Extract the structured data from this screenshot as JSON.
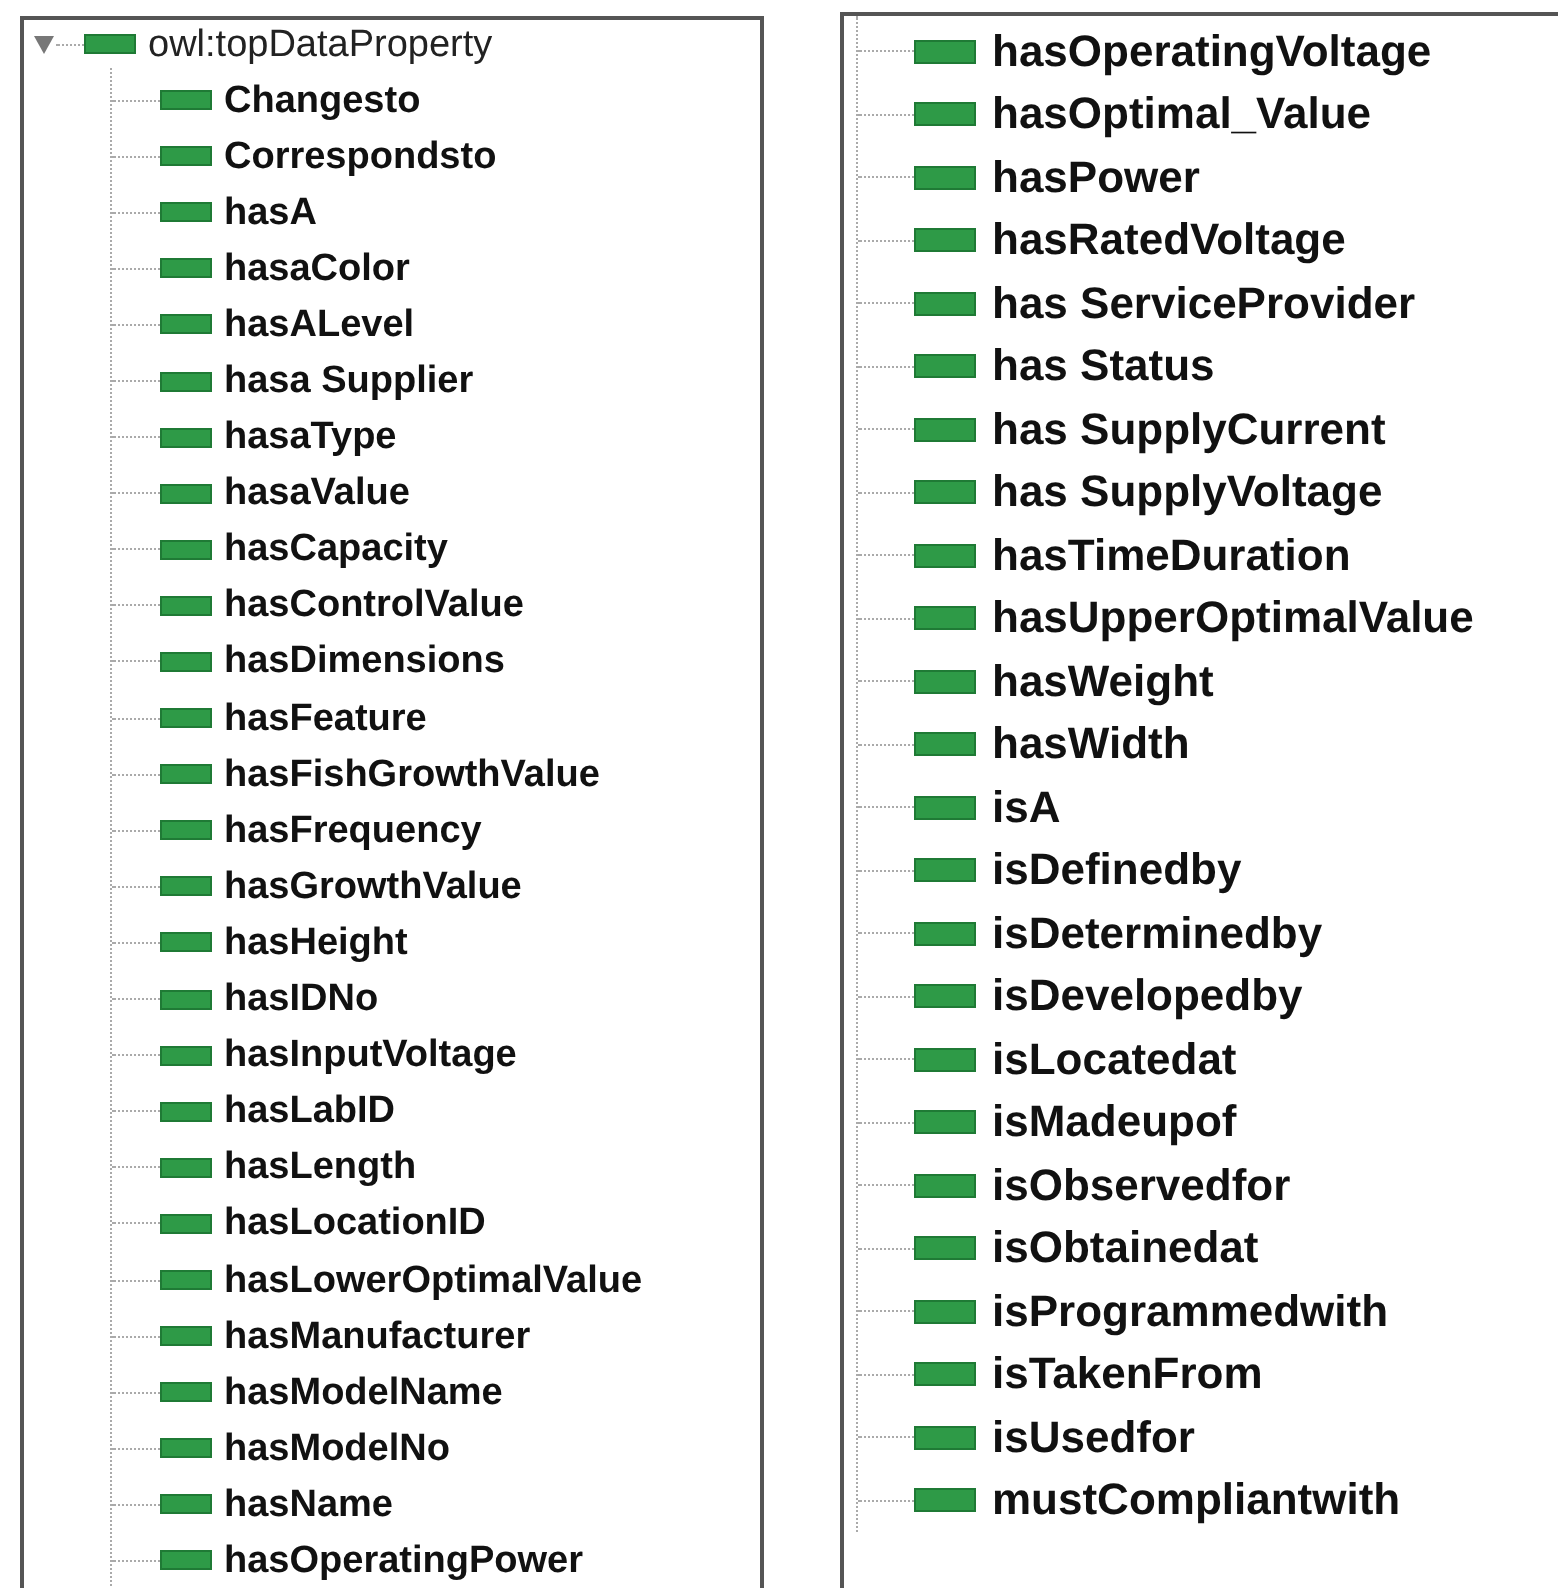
{
  "panels": [
    {
      "root": {
        "label": "owl:topDataProperty",
        "expanded": true
      },
      "children": [
        {
          "label": "Changesto"
        },
        {
          "label": "Correspondsto"
        },
        {
          "label": "hasA"
        },
        {
          "label": "hasaColor"
        },
        {
          "label": "hasALevel"
        },
        {
          "label": "hasa Supplier"
        },
        {
          "label": "hasaType"
        },
        {
          "label": "hasaValue"
        },
        {
          "label": "hasCapacity"
        },
        {
          "label": "hasControlValue"
        },
        {
          "label": "hasDimensions"
        },
        {
          "label": "hasFeature"
        },
        {
          "label": "hasFishGrowthValue"
        },
        {
          "label": "hasFrequency"
        },
        {
          "label": "hasGrowthValue"
        },
        {
          "label": "hasHeight"
        },
        {
          "label": "hasIDNo"
        },
        {
          "label": "hasInputVoltage"
        },
        {
          "label": "hasLabID"
        },
        {
          "label": "hasLength"
        },
        {
          "label": "hasLocationID"
        },
        {
          "label": "hasLowerOptimalValue"
        },
        {
          "label": "hasManufacturer"
        },
        {
          "label": "hasModelName"
        },
        {
          "label": "hasModelNo"
        },
        {
          "label": "hasName"
        },
        {
          "label": "hasOperatingPower"
        }
      ]
    },
    {
      "children": [
        {
          "label": "hasOperatingVoltage"
        },
        {
          "label": "hasOptimal_Value"
        },
        {
          "label": "hasPower"
        },
        {
          "label": "hasRatedVoltage"
        },
        {
          "label": "has ServiceProvider"
        },
        {
          "label": "has Status"
        },
        {
          "label": "has SupplyCurrent"
        },
        {
          "label": "has SupplyVoltage"
        },
        {
          "label": "hasTimeDuration"
        },
        {
          "label": "hasUpperOptimalValue"
        },
        {
          "label": "hasWeight"
        },
        {
          "label": "hasWidth"
        },
        {
          "label": "isA"
        },
        {
          "label": "isDefinedby"
        },
        {
          "label": "isDeterminedby"
        },
        {
          "label": "isDevelopedby"
        },
        {
          "label": "isLocatedat"
        },
        {
          "label": "isMadeupof"
        },
        {
          "label": "isObservedfor"
        },
        {
          "label": "isObtainedat"
        },
        {
          "label": "isProgrammedwith"
        },
        {
          "label": "isTakenFrom"
        },
        {
          "label": "isUsedfor"
        },
        {
          "label": "mustCompliantwith"
        }
      ]
    }
  ]
}
